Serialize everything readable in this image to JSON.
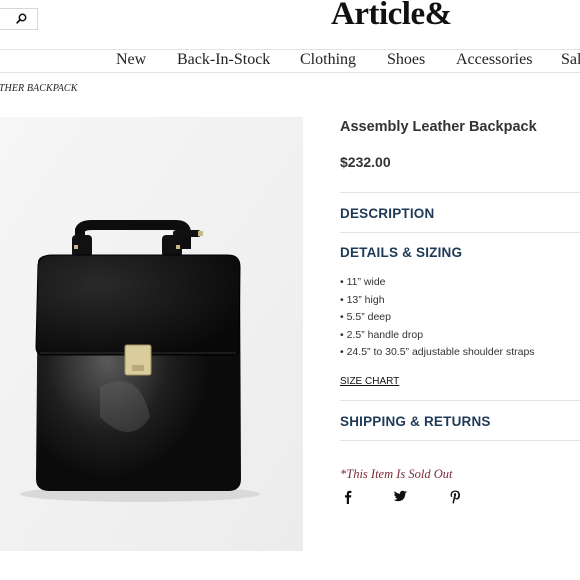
{
  "header": {
    "logo": "Article&",
    "search_icon": "search-icon"
  },
  "nav": {
    "items": [
      "New",
      "Back-In-Stock",
      "Clothing",
      "Shoes",
      "Accessories",
      "Sal"
    ]
  },
  "breadcrumb": "ATHER BACKPACK",
  "product": {
    "title": "Assembly Leather Backpack",
    "price": "$232.00",
    "sections": {
      "description": "DESCRIPTION",
      "details": "DETAILS & SIZING",
      "shipping": "SHIPPING & RETURNS"
    },
    "details": [
      "11” wide",
      "13” high",
      "5.5” deep",
      "2.5” handle drop",
      "24.5” to 30.5” adjustable shoulder straps"
    ],
    "size_chart": "SIZE CHART",
    "sold_out": "*This Item Is Sold Out"
  },
  "share": {
    "icons": [
      "facebook-icon",
      "twitter-icon",
      "pinterest-icon"
    ]
  },
  "colors": {
    "section_heading": "#1f3a57",
    "sold_out": "#7a2a3c",
    "image_bg": "#f1f1f1"
  }
}
